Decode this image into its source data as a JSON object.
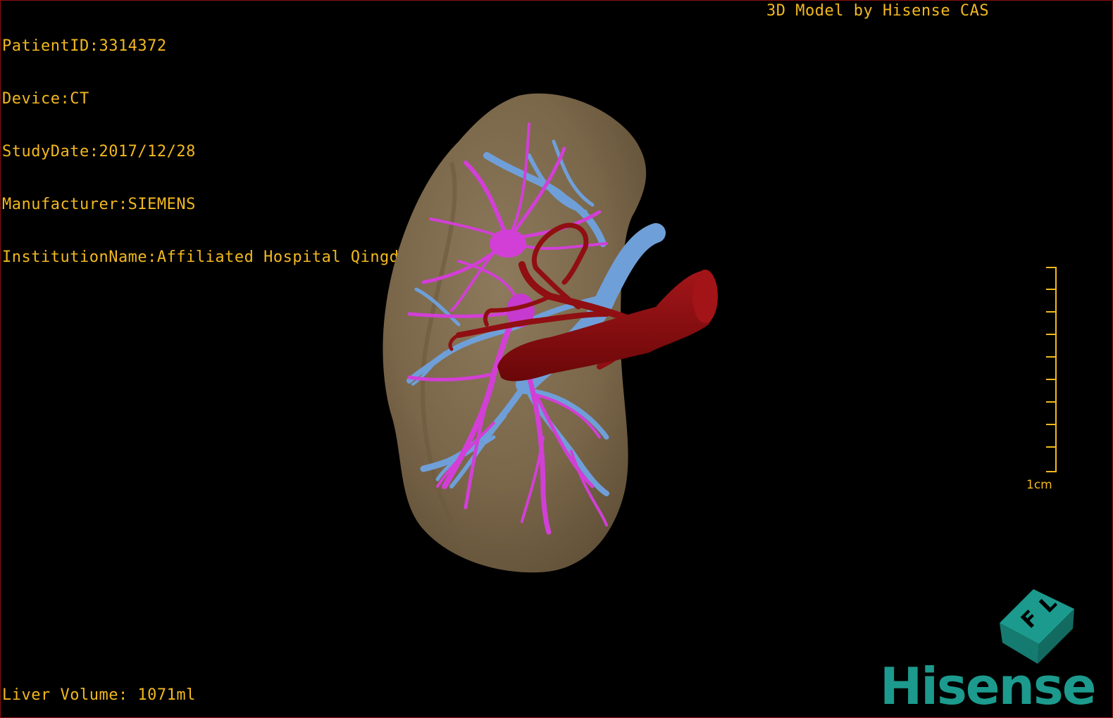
{
  "overlay": {
    "info_lines": [
      "PatientID:3314372",
      "Device:CT",
      "StudyDate:2017/12/28",
      "Manufacturer:SIEMENS",
      "InstitutionName:Affiliated Hospital Qingdao University-C"
    ],
    "credit": "3D Model by Hisense CAS",
    "volume": "Liver Volume: 1071ml"
  },
  "scale": {
    "label": "1cm"
  },
  "orientation_cube": {
    "letters": [
      "F",
      "L"
    ]
  },
  "brand": {
    "name": "Hisense"
  },
  "colors": {
    "text": "#f2b81f",
    "liver": "#7d6a4e",
    "hepatic_vein": "#d23fd6",
    "portal_vein": "#6f9fd8",
    "artery_ivc": "#8f0f12",
    "brand": "#1c9a8d",
    "border": "#8b1010"
  }
}
